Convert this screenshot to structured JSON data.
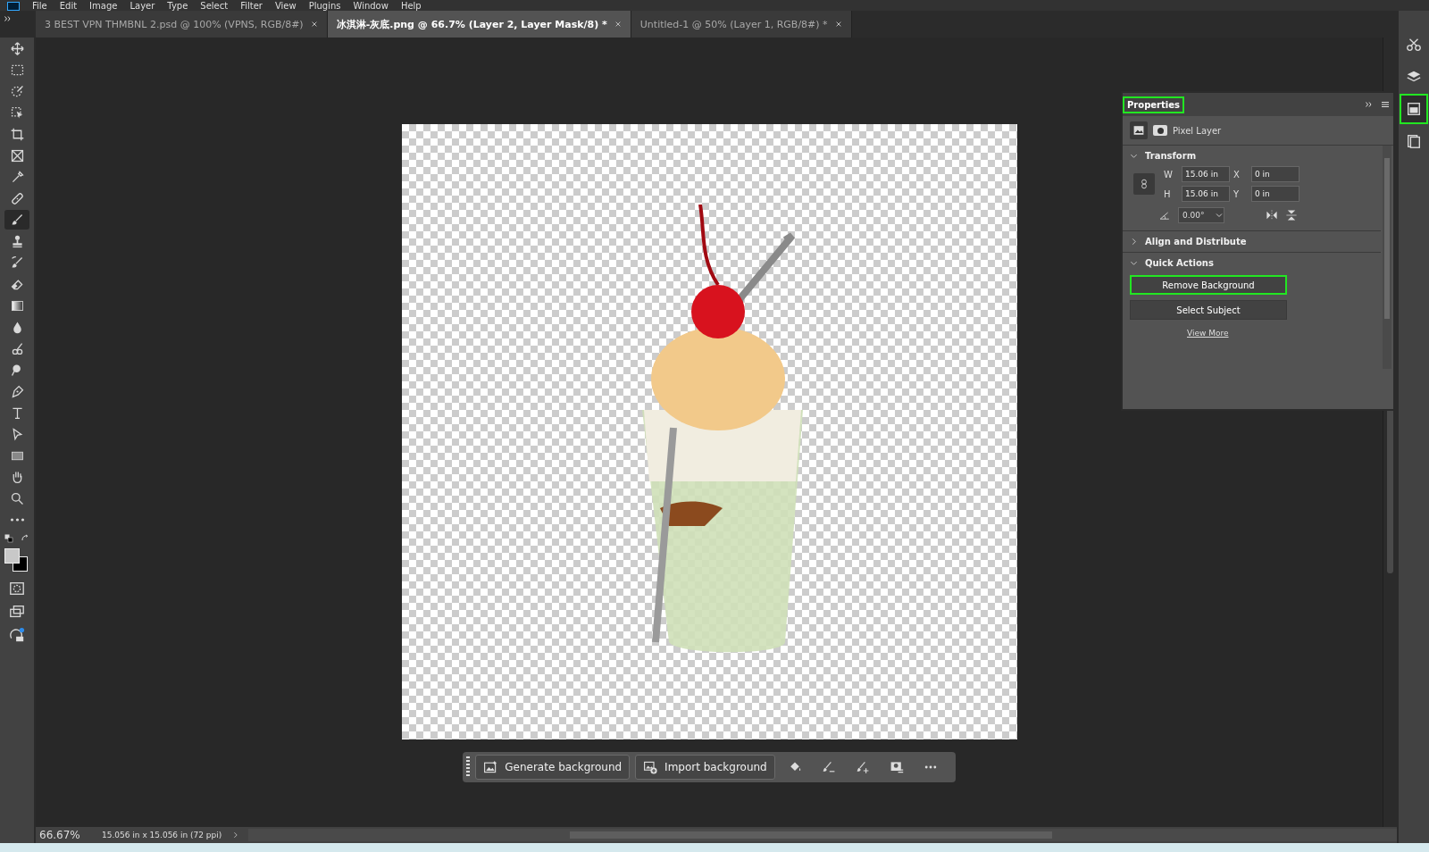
{
  "menu": [
    "File",
    "Edit",
    "Image",
    "Layer",
    "Type",
    "Select",
    "Filter",
    "View",
    "Plugins",
    "Window",
    "Help"
  ],
  "tabs": [
    {
      "label": "3 BEST VPN THMBNL 2.psd @ 100% (VPNS, RGB/8#)",
      "selected": false
    },
    {
      "label": "冰淇淋-灰底.png @ 66.7% (Layer 2, Layer Mask/8) *",
      "selected": true
    },
    {
      "label": "Untitled-1 @ 50% (Layer 1, RGB/8#) *",
      "selected": false
    }
  ],
  "tools": [
    {
      "kind": "move",
      "selected": false
    },
    {
      "kind": "marquee",
      "selected": false
    },
    {
      "kind": "quick-select",
      "selected": false
    },
    {
      "kind": "object-select",
      "selected": false
    },
    {
      "kind": "crop",
      "selected": false
    },
    {
      "kind": "frame",
      "selected": false
    },
    {
      "kind": "eyedropper",
      "selected": false
    },
    {
      "kind": "healing",
      "selected": false
    },
    {
      "kind": "brush",
      "selected": true
    },
    {
      "kind": "stamp",
      "selected": false
    },
    {
      "kind": "history",
      "selected": false
    },
    {
      "kind": "eraser",
      "selected": false
    },
    {
      "kind": "gradient",
      "selected": false
    },
    {
      "kind": "blur",
      "selected": false
    },
    {
      "kind": "dodge",
      "selected": false
    },
    {
      "kind": "search",
      "selected": false
    },
    {
      "kind": "pen",
      "selected": false
    },
    {
      "kind": "type",
      "selected": false
    },
    {
      "kind": "path-select",
      "selected": false
    },
    {
      "kind": "rectangle",
      "selected": false
    },
    {
      "kind": "hand",
      "selected": false
    },
    {
      "kind": "zoom",
      "selected": false
    },
    {
      "kind": "more",
      "selected": false
    }
  ],
  "properties": {
    "title": "Properties",
    "title_highlighted": true,
    "layer_type": "Pixel Layer",
    "transform": {
      "heading": "Transform",
      "expanded": true,
      "w_label": "W",
      "w": "15.06 in",
      "x_label": "X",
      "x": "0 in",
      "h_label": "H",
      "h": "15.06 in",
      "y_label": "Y",
      "y": "0 in",
      "angle": "0.00°"
    },
    "align": {
      "heading": "Align and Distribute",
      "expanded": false
    },
    "quick_actions": {
      "heading": "Quick Actions",
      "expanded": true,
      "buttons": [
        {
          "label": "Remove Background",
          "highlighted": true
        },
        {
          "label": "Select Subject",
          "highlighted": false
        }
      ],
      "link": "View More"
    }
  },
  "dock": [
    {
      "kind": "tools",
      "selected": false,
      "highlighted": false
    },
    {
      "kind": "layers",
      "selected": false,
      "highlighted": false
    },
    {
      "kind": "properties",
      "selected": true,
      "highlighted": true
    },
    {
      "kind": "libraries",
      "selected": false,
      "highlighted": false
    }
  ],
  "context_bar": {
    "buttons": [
      {
        "kind": "generate",
        "label": "Generate background"
      },
      {
        "kind": "import",
        "label": "Import background"
      }
    ],
    "icons": [
      {
        "kind": "fill"
      },
      {
        "kind": "brush-minus"
      },
      {
        "kind": "brush-plus"
      },
      {
        "kind": "mask"
      },
      {
        "kind": "more"
      }
    ]
  },
  "status": {
    "zoom": "66.67%",
    "doc_size": "15.056 in x 15.056 in (72 ppi)"
  }
}
